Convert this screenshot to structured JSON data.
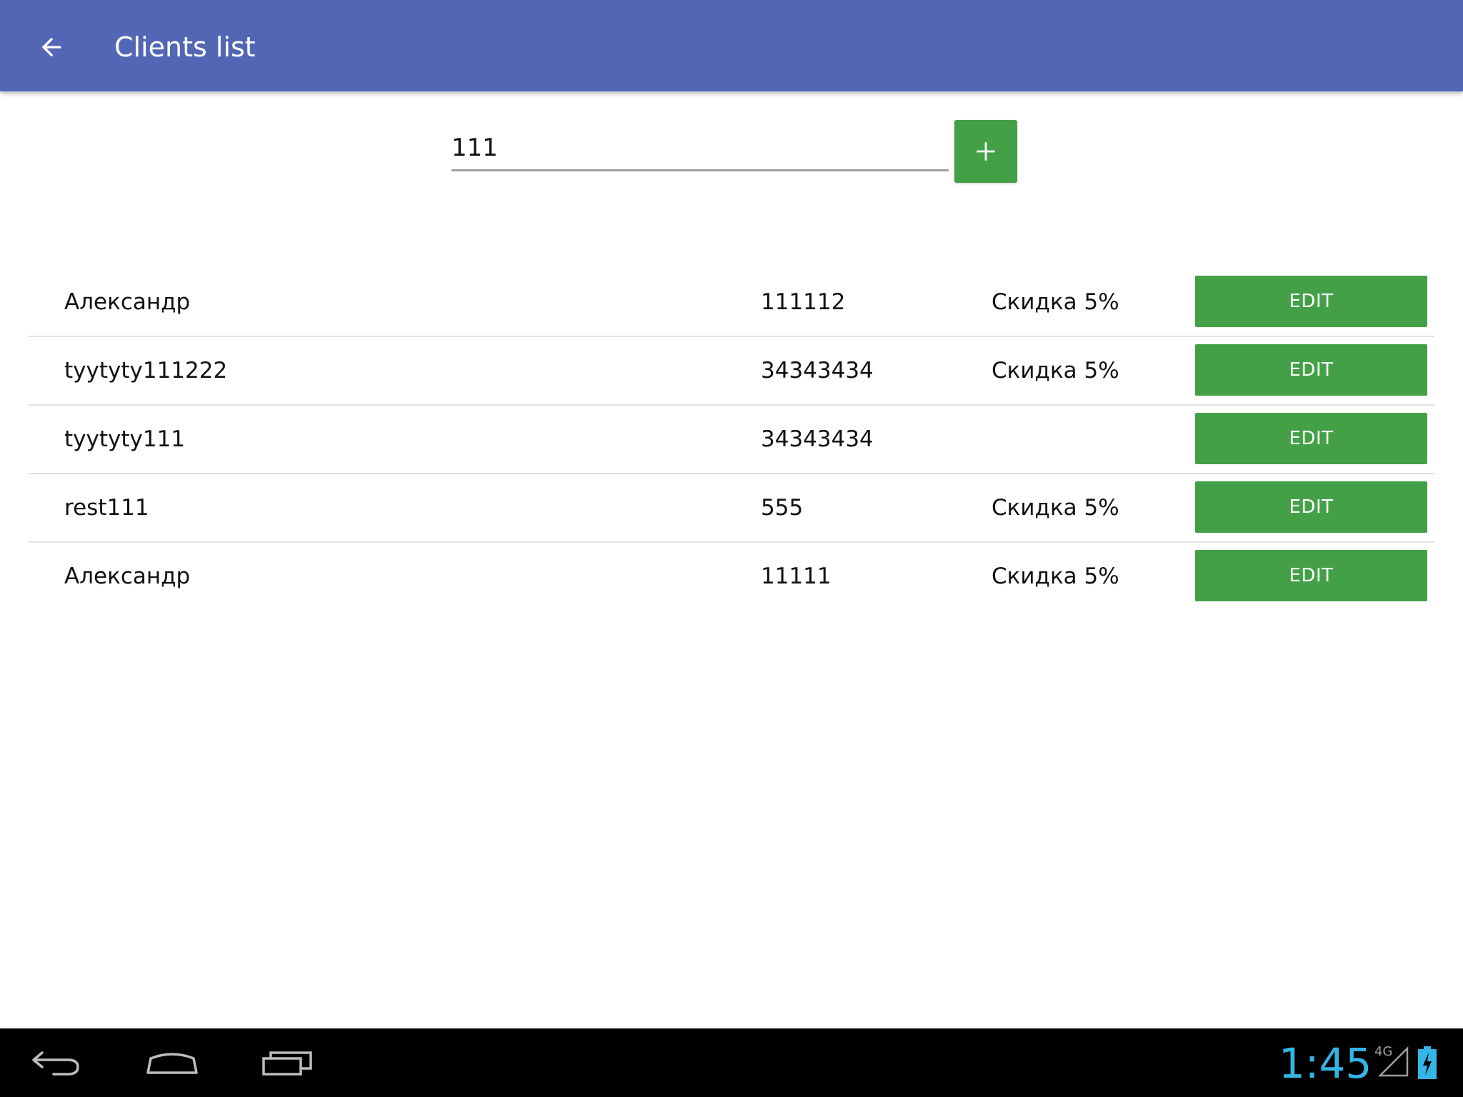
{
  "app_bar": {
    "title": "Clients list",
    "back_icon": "arrow-back-icon",
    "color": "#5366b5"
  },
  "search": {
    "value": "111",
    "add_icon": "plus-icon",
    "add_color": "#43a047"
  },
  "clients": [
    {
      "name": "Александр",
      "phone": "111112",
      "discount": "Скидка 5%",
      "action": "EDIT"
    },
    {
      "name": "tyytyty111222",
      "phone": "34343434",
      "discount": "Скидка 5%",
      "action": "EDIT"
    },
    {
      "name": "tyytyty111",
      "phone": "34343434",
      "discount": "",
      "action": "EDIT"
    },
    {
      "name": "rest111",
      "phone": "555",
      "discount": "Скидка 5%",
      "action": "EDIT"
    },
    {
      "name": "Александр",
      "phone": "11111",
      "discount": "Скидка 5%",
      "action": "EDIT"
    }
  ],
  "system_bar": {
    "time": "1:45",
    "network": "4G",
    "clock_color": "#33b5e5",
    "icons": [
      "nav-back-icon",
      "nav-home-icon",
      "nav-recents-icon",
      "signal-icon",
      "battery-charging-icon"
    ]
  }
}
